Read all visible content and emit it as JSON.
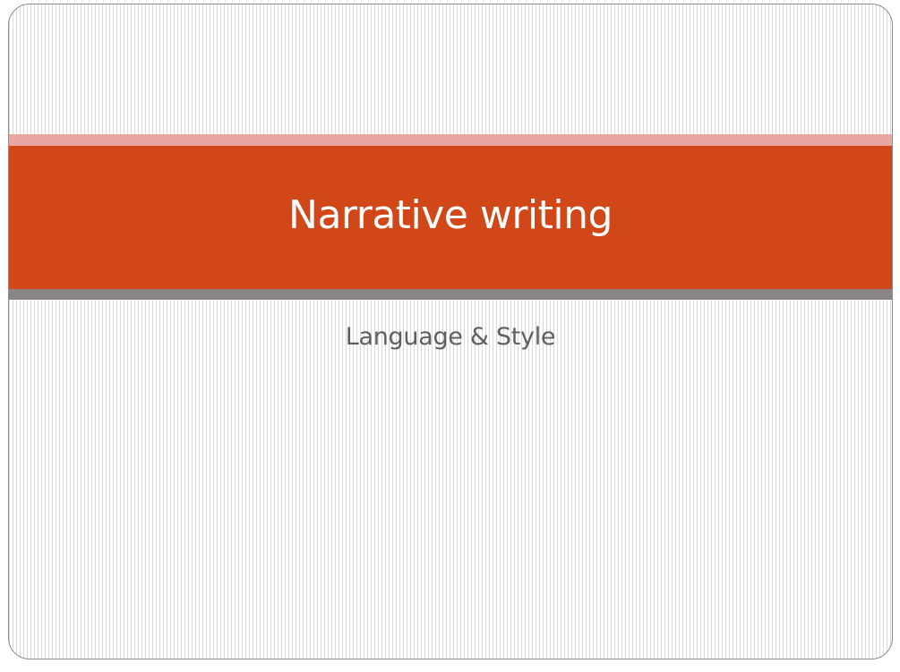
{
  "slide": {
    "title": "Narrative writing",
    "subtitle": "Language & Style"
  },
  "colors": {
    "title_band": "#d24717",
    "top_accent": "#e8a7a0",
    "bottom_accent": "#8c8585",
    "title_text": "#ffffff",
    "subtitle_text": "#5f5f5f",
    "background_stripe": "#d9d9d9"
  }
}
